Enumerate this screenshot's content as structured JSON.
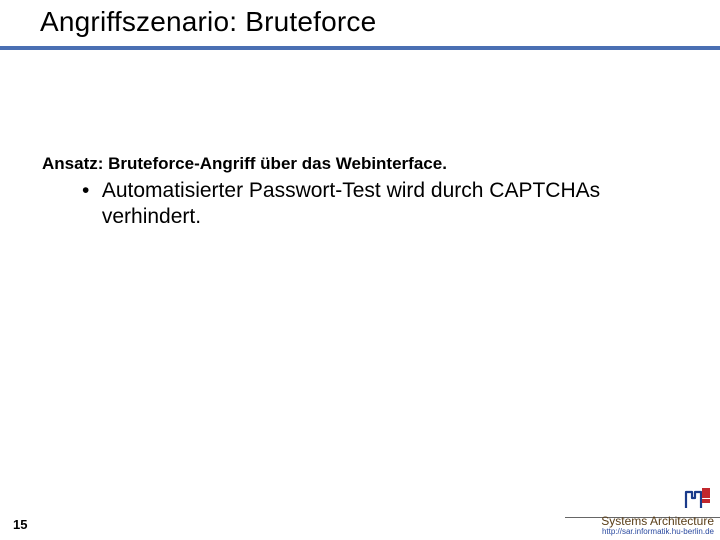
{
  "title": "Angriffszenario: Bruteforce",
  "ansatz": "Ansatz: Bruteforce-Angriff über das Webinterface.",
  "bullets": [
    "Automatisierter Passwort-Test wird durch CAPTCHAs verhindert."
  ],
  "page_number": "15",
  "footer": {
    "department": "Systems Architecture",
    "url": "http://sar.informatik.hu-berlin.de"
  },
  "colors": {
    "rule": "#4a6fb3",
    "dept": "#5a3e18",
    "url": "#2a4aa0"
  }
}
